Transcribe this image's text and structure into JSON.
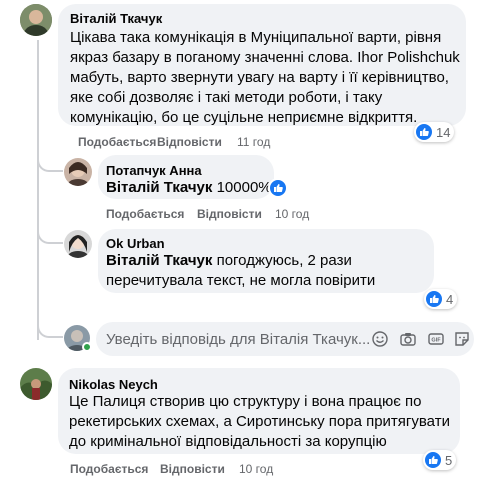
{
  "comments": [
    {
      "author": "Віталій Ткачук",
      "text": "Цікава така комунікація в Муніципальної варти, рівня якраз базару в поганому значенні слова. Ihor Polishchuk мабуть, варто звернути увагу на варту і її керівництво, яке собі дозволяє і такі методи роботи, і таку комунікацію, бо це суцільне неприємне відкриття.",
      "like_label": "Подобається",
      "reply_label": "Відповісти",
      "time": "11 год",
      "reaction_count": "14"
    },
    {
      "author": "Потапчук Анна",
      "mention": "Віталій Ткачук",
      "text": " 10000%",
      "like_label": "Подобається",
      "reply_label": "Відповісти",
      "time": "10 год"
    },
    {
      "author": "Ok Urban",
      "mention": "Віталій Ткачук",
      "text": " погоджуюсь, 2 рази перечитувала текст, не могла повірити",
      "like_label": "Подобається",
      "reply_label": "Відповісти",
      "time": "10 год",
      "reaction_count": "4"
    },
    {
      "author": "Nikolas Neych",
      "text": "Це Палиця створив цю структуру і вона працює по рекетирських схемах, а Сиротинську пора притягувати до кримінальної відповідальності за корупцію",
      "like_label": "Подобається",
      "reply_label": "Відповісти",
      "time": "10 год",
      "reaction_count": "5"
    }
  ],
  "reply_input": {
    "placeholder": "Уведіть відповідь для Віталія Ткачук..."
  },
  "icons": [
    "like-reaction-icon",
    "emoji-icon",
    "camera-icon",
    "gif-icon",
    "sticker-icon"
  ],
  "colors": {
    "bubble": "#f0f2f5",
    "accent": "#1877f2",
    "meta": "#65676b",
    "online": "#31a24c"
  }
}
